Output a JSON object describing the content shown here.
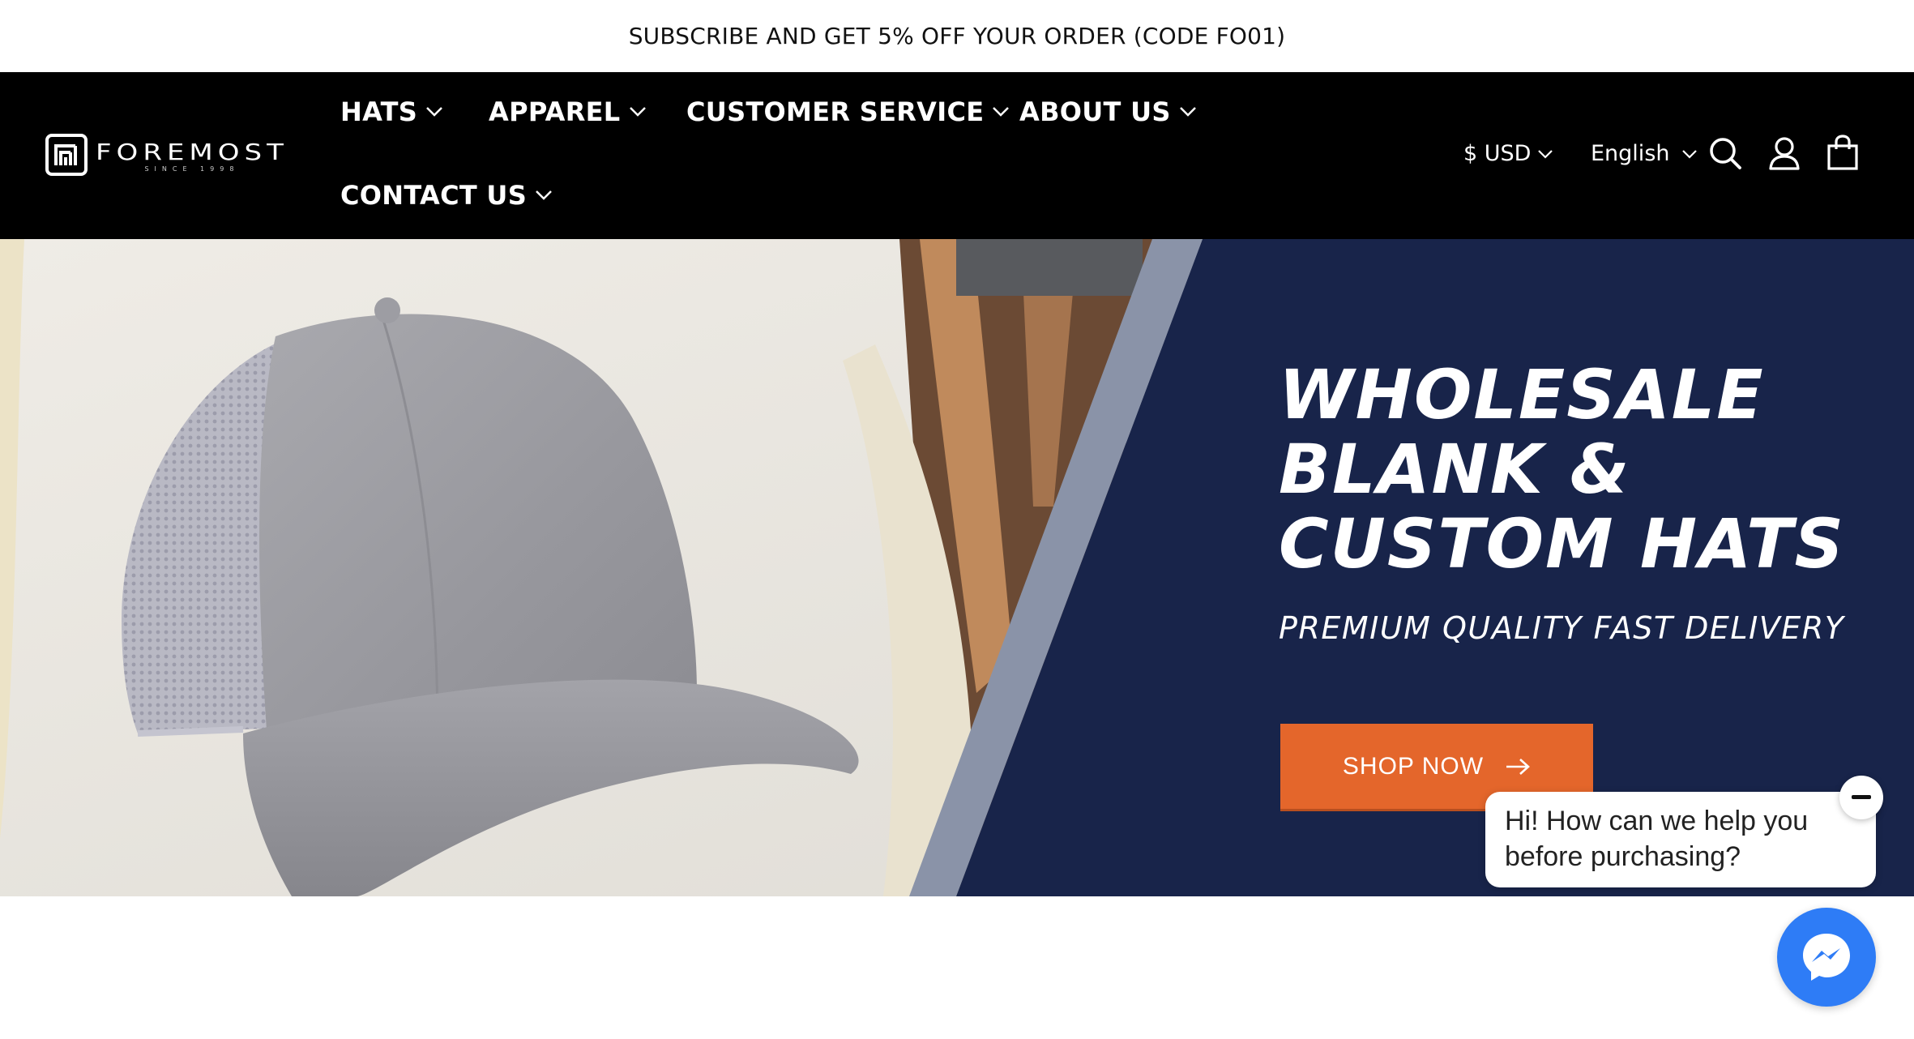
{
  "announcement": {
    "text": "SUBSCRIBE AND GET 5% OFF YOUR ORDER (CODE FO01)"
  },
  "brand": {
    "name": "FOREMOST",
    "tagline": "SINCE 1998"
  },
  "nav": {
    "items": [
      {
        "label": "HATS"
      },
      {
        "label": "APPAREL"
      },
      {
        "label": "CUSTOMER SERVICE"
      },
      {
        "label": "ABOUT US"
      },
      {
        "label": "CONTACT US"
      }
    ]
  },
  "utilities": {
    "currency": "$ USD",
    "language": "English",
    "icons": [
      "search-icon",
      "account-icon",
      "cart-icon"
    ]
  },
  "hero": {
    "title_lines": [
      "WHOLESALE",
      "BLANK &",
      "CUSTOM HATS"
    ],
    "subtitle": "PREMIUM QUALITY FAST DELIVERY",
    "cta_label": "SHOP NOW",
    "colors": {
      "panel": "#18244a",
      "stripe": "#8a93a8",
      "cta": "#e4662b"
    }
  },
  "chat": {
    "message_line1": "Hi! How can we help you",
    "message_line2": "before purchasing?",
    "color": "#2e7cf6"
  }
}
